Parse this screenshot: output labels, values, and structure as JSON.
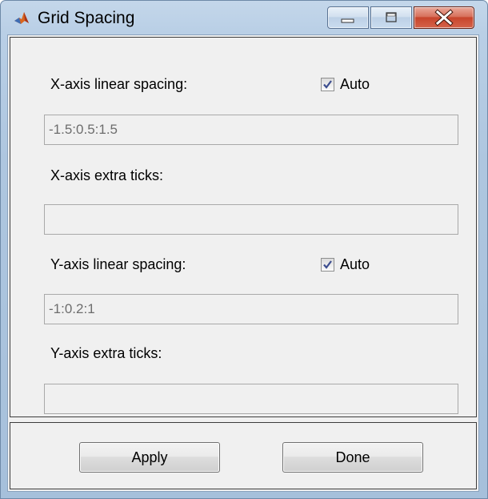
{
  "window": {
    "title": "Grid Spacing"
  },
  "icons": {
    "app": "matlab-icon",
    "minimize": "minimize-icon",
    "maximize": "maximize-icon",
    "close": "close-icon",
    "check": "checkmark-icon"
  },
  "x_axis": {
    "linear_spacing_label": "X-axis linear spacing:",
    "auto_label": "Auto",
    "auto_checked": true,
    "linear_spacing_value": "-1.5:0.5:1.5",
    "extra_ticks_label": "X-axis extra ticks:",
    "extra_ticks_value": ""
  },
  "y_axis": {
    "linear_spacing_label": "Y-axis linear spacing:",
    "auto_label": "Auto",
    "auto_checked": true,
    "linear_spacing_value": "-1:0.2:1",
    "extra_ticks_label": "Y-axis extra ticks:",
    "extra_ticks_value": ""
  },
  "buttons": {
    "apply_label": "Apply",
    "done_label": "Done"
  },
  "colors": {
    "close_button": "#c7452c",
    "window_frame": "#b9cfe6",
    "client_background": "#f0f0f0"
  }
}
